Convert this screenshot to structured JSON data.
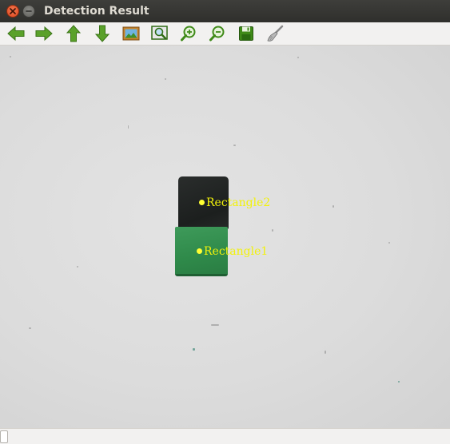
{
  "window": {
    "title": "Detection Result"
  },
  "toolbar": {
    "buttons": [
      {
        "name": "pan-left",
        "icon": "arrow-left-icon"
      },
      {
        "name": "pan-right",
        "icon": "arrow-right-icon"
      },
      {
        "name": "pan-up",
        "icon": "arrow-up-icon"
      },
      {
        "name": "pan-down",
        "icon": "arrow-down-icon"
      },
      {
        "name": "zoom-fit",
        "icon": "picture-icon"
      },
      {
        "name": "zoom-region",
        "icon": "zoom-region-icon"
      },
      {
        "name": "zoom-in",
        "icon": "zoom-in-icon"
      },
      {
        "name": "zoom-out",
        "icon": "zoom-out-icon"
      },
      {
        "name": "save-image",
        "icon": "save-icon"
      },
      {
        "name": "properties",
        "icon": "brush-icon"
      }
    ]
  },
  "canvas": {
    "detections": [
      {
        "label": "Rectangle2",
        "object": "dark-cube"
      },
      {
        "label": "Rectangle1",
        "object": "green-cube"
      }
    ],
    "colors": {
      "marker": "#ffff33",
      "label": "#f2f20a",
      "background": "#dcdcdc"
    }
  },
  "statusbar": {
    "text": ""
  }
}
